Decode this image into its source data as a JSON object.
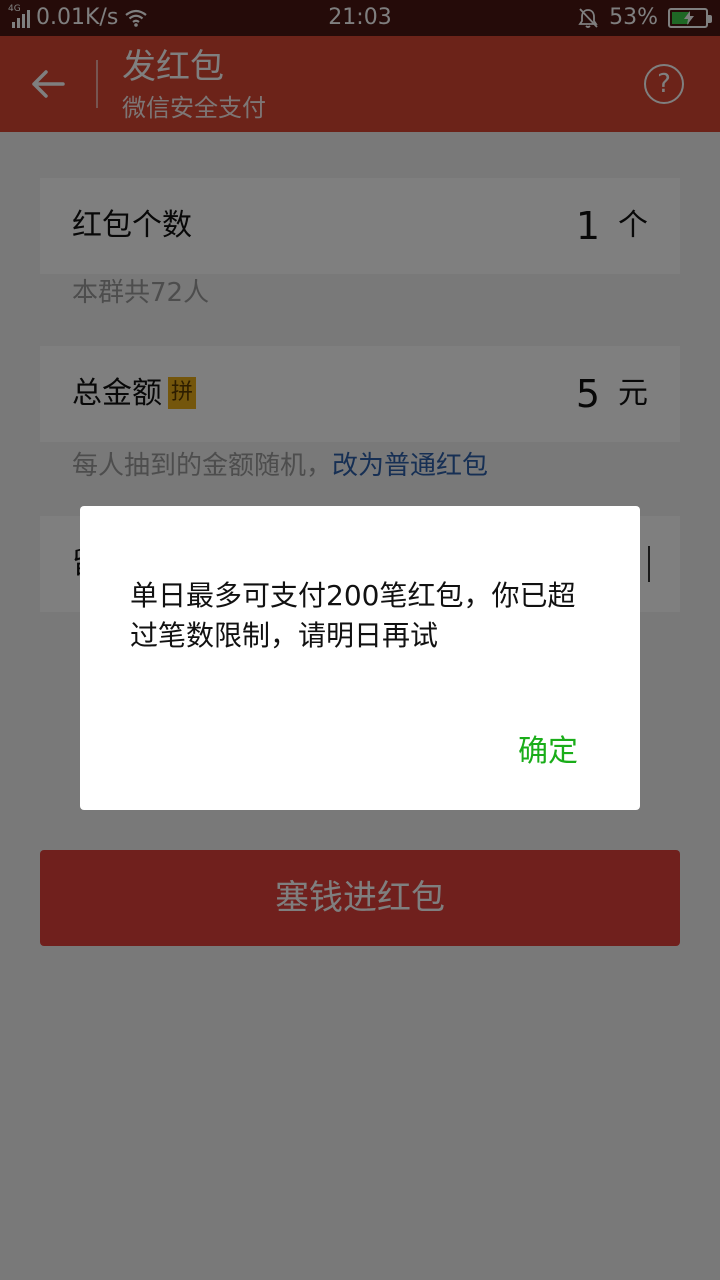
{
  "status_bar": {
    "network_tag": "4G",
    "speed": "0.01K/s",
    "time": "21:03",
    "battery": "53%",
    "battery_level": 0.53
  },
  "header": {
    "title": "发红包",
    "subtitle": "微信安全支付",
    "help_glyph": "?"
  },
  "form": {
    "count": {
      "label": "红包个数",
      "value": "1",
      "unit": "个"
    },
    "group_hint": "本群共72人",
    "amount": {
      "label": "总金额",
      "badge": "拼",
      "value": "5",
      "unit": "元"
    },
    "amount_hint": "每人抽到的金额随机，",
    "amount_hint_link": "改为普通红包",
    "message_prefix": "留"
  },
  "submit_label": "塞钱进红包",
  "dialog": {
    "message": "单日最多可支付200笔红包，你已超过笔数限制，请明日再试",
    "confirm": "确定"
  },
  "colors": {
    "header": "#d94632",
    "button": "#e0413a",
    "link": "#2c5fa8",
    "confirm": "#1aad19"
  }
}
